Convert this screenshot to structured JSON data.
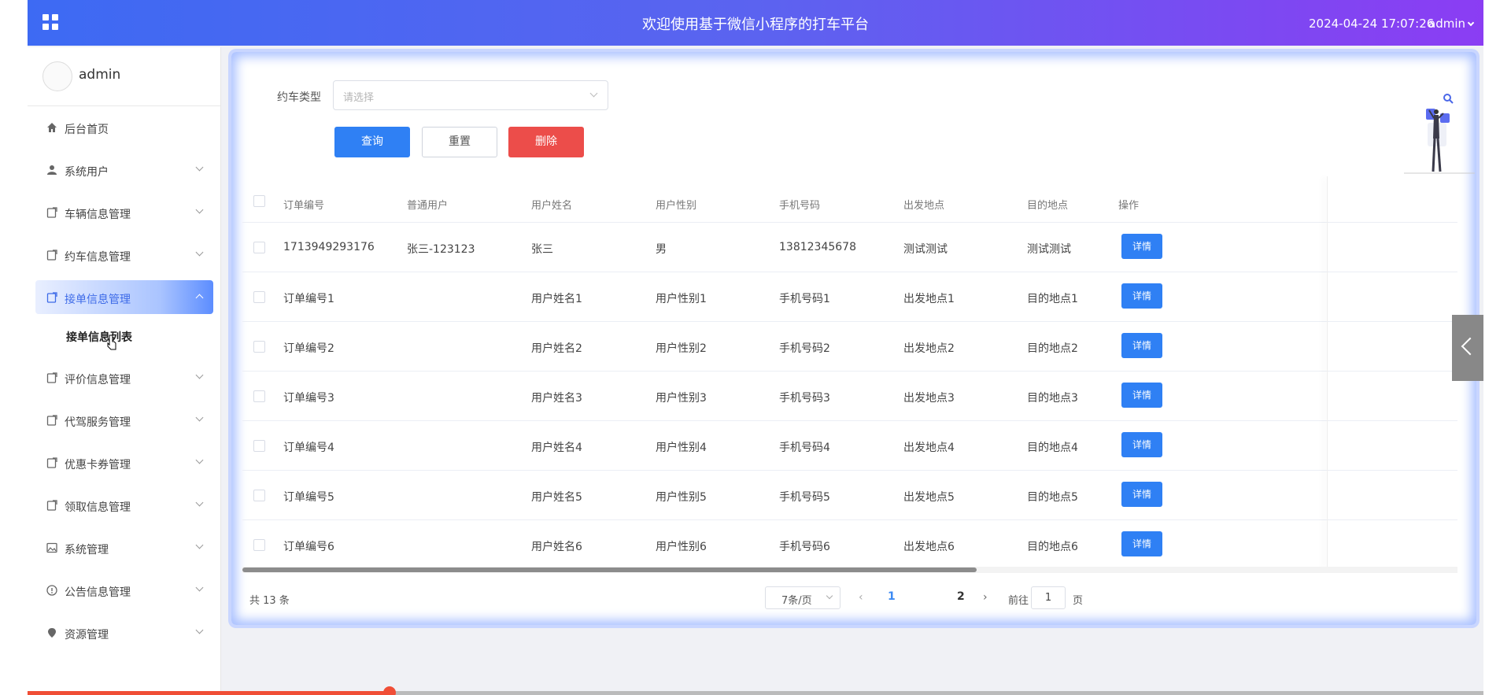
{
  "header": {
    "title": "欢迎使用基于微信小程序的打车平台",
    "datetime": "2024-04-24 17:07:26",
    "user": "admin"
  },
  "sidebar": {
    "profile_name": "admin",
    "items": [
      {
        "label": "后台首页",
        "icon": "home-icon"
      },
      {
        "label": "系统用户",
        "icon": "user-icon"
      },
      {
        "label": "车辆信息管理",
        "icon": "document-icon"
      },
      {
        "label": "约车信息管理",
        "icon": "document-icon"
      },
      {
        "label": "接单信息管理",
        "icon": "document-icon",
        "active": true
      },
      {
        "label": "评价信息管理",
        "icon": "document-icon"
      },
      {
        "label": "代驾服务管理",
        "icon": "document-icon"
      },
      {
        "label": "优惠卡券管理",
        "icon": "document-icon"
      },
      {
        "label": "领取信息管理",
        "icon": "document-icon"
      },
      {
        "label": "系统管理",
        "icon": "image-icon"
      },
      {
        "label": "公告信息管理",
        "icon": "info-icon"
      },
      {
        "label": "资源管理",
        "icon": "location-icon"
      }
    ],
    "submenu_label": "接单信息列表"
  },
  "filter": {
    "label": "约车类型",
    "placeholder": "请选择",
    "query_label": "查询",
    "reset_label": "重置",
    "delete_label": "删除"
  },
  "table": {
    "headers": [
      "订单编号",
      "普通用户",
      "用户姓名",
      "用户性别",
      "手机号码",
      "出发地点",
      "目的地点",
      "操作"
    ],
    "rows": [
      [
        "1713949293176",
        "张三-123123",
        "张三",
        "男",
        "13812345678",
        "测试测试",
        "测试测试"
      ],
      [
        "订单编号1",
        "",
        "用户姓名1",
        "用户性别1",
        "手机号码1",
        "出发地点1",
        "目的地点1"
      ],
      [
        "订单编号2",
        "",
        "用户姓名2",
        "用户性别2",
        "手机号码2",
        "出发地点2",
        "目的地点2"
      ],
      [
        "订单编号3",
        "",
        "用户姓名3",
        "用户性别3",
        "手机号码3",
        "出发地点3",
        "目的地点3"
      ],
      [
        "订单编号4",
        "",
        "用户姓名4",
        "用户性别4",
        "手机号码4",
        "出发地点4",
        "目的地点4"
      ],
      [
        "订单编号5",
        "",
        "用户姓名5",
        "用户性别5",
        "手机号码5",
        "出发地点5",
        "目的地点5"
      ],
      [
        "订单编号6",
        "",
        "用户姓名6",
        "用户性别6",
        "手机号码6",
        "出发地点6",
        "目的地点6"
      ]
    ],
    "detail_label": "详情"
  },
  "pagination": {
    "total": "共 13 条",
    "page_size": "7条/页",
    "pages": [
      "1",
      "2"
    ],
    "current": "1",
    "goto_prefix": "前往",
    "goto_value": "1",
    "goto_suffix": "页"
  },
  "colors": {
    "primary": "#2f80f4",
    "danger": "#ec4d4a",
    "header_start": "#3d6af3",
    "header_end": "#8b3df3"
  }
}
